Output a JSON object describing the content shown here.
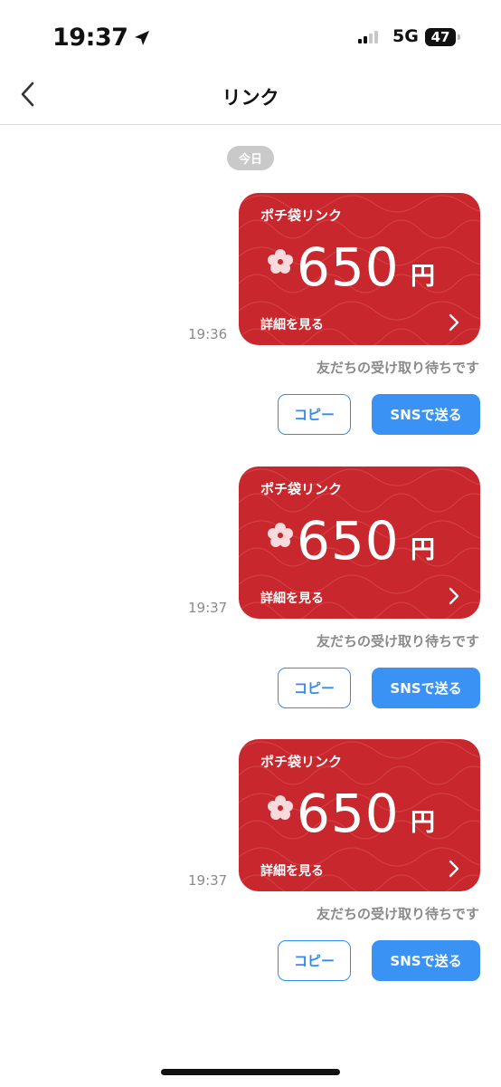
{
  "status_bar": {
    "time": "19:37",
    "network": "5G",
    "battery": "47",
    "icons": [
      "location-arrow-icon",
      "signal-icon"
    ]
  },
  "nav": {
    "title": "リンク",
    "back_icon": "chevron-left-icon"
  },
  "date_chip": "今日",
  "messages": [
    {
      "time": "19:36",
      "card_label": "ポチ袋リンク",
      "amount": "650",
      "currency": "円",
      "detail_label": "詳細を見る",
      "status": "友だちの受け取り待ちです",
      "copy_label": "コピー",
      "sns_label": "SNSで送る"
    },
    {
      "time": "19:37",
      "card_label": "ポチ袋リンク",
      "amount": "650",
      "currency": "円",
      "detail_label": "詳細を見る",
      "status": "友だちの受け取り待ちです",
      "copy_label": "コピー",
      "sns_label": "SNSで送る"
    },
    {
      "time": "19:37",
      "card_label": "ポチ袋リンク",
      "amount": "650",
      "currency": "円",
      "detail_label": "詳細を見る",
      "status": "友だちの受け取り待ちです",
      "copy_label": "コピー",
      "sns_label": "SNSで送る"
    }
  ],
  "colors": {
    "card_red": "#c8272d",
    "accent_blue": "#3a93f4",
    "muted_text": "#8a8a8a"
  }
}
